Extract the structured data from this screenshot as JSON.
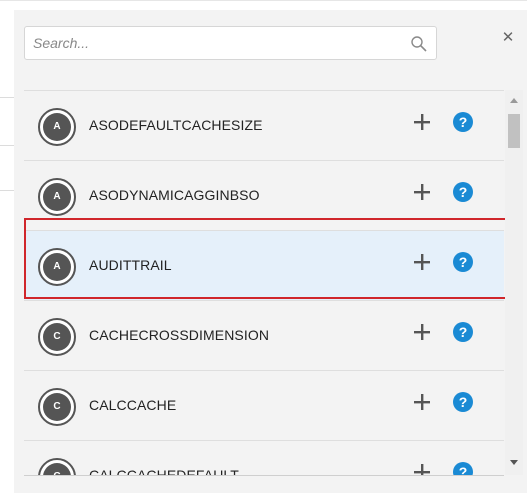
{
  "search": {
    "placeholder": "Search..."
  },
  "items": [
    {
      "badge": "A",
      "label": "ASODEFAULTCACHESIZE",
      "selected": false
    },
    {
      "badge": "A",
      "label": "ASODYNAMICAGGINBSO",
      "selected": false
    },
    {
      "badge": "A",
      "label": "AUDITTRAIL",
      "selected": true
    },
    {
      "badge": "C",
      "label": "CACHECROSSDIMENSION",
      "selected": false
    },
    {
      "badge": "C",
      "label": "CALCCACHE",
      "selected": false
    },
    {
      "badge": "C",
      "label": "CALCCACHEDEFAULT",
      "selected": false
    }
  ],
  "colors": {
    "accent": "#1a8ad4",
    "highlight_border": "#d0262b",
    "selected_row": "#e5f0fa",
    "avatar": "#555555"
  },
  "icons": {
    "search": "search-icon",
    "close": "close-icon",
    "add": "plus-icon",
    "help": "help-icon"
  }
}
